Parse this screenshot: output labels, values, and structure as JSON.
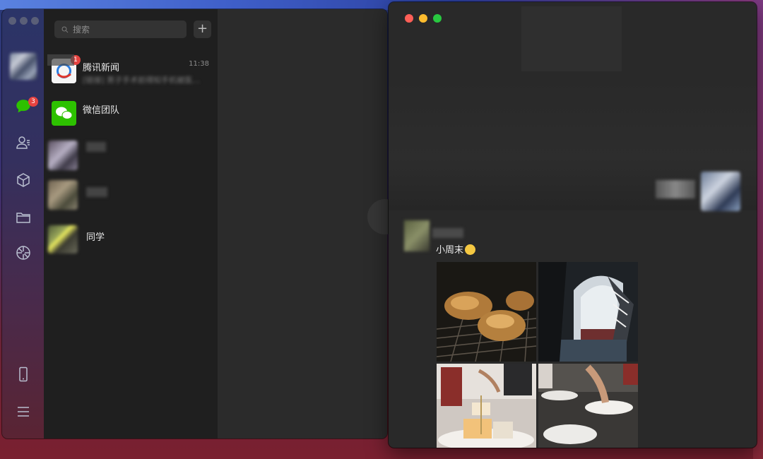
{
  "sidebar": {
    "chat_badge": "3",
    "icons": [
      "chat-icon",
      "contacts-icon",
      "cube-icon",
      "folder-icon",
      "moments-icon",
      "phone-icon",
      "menu-icon"
    ]
  },
  "chat_list": {
    "search_placeholder": "搜索",
    "add_label": "+",
    "items": [
      {
        "name": "腾讯新闻",
        "time": "11:38",
        "preview": "[链接] 男子手术前得知手机被医…",
        "badge": "1"
      },
      {
        "name": "微信团队",
        "time": "",
        "preview": ""
      },
      {
        "name": "",
        "time": "",
        "preview": ""
      },
      {
        "name": "",
        "time": "",
        "preview": ""
      },
      {
        "name": "同学",
        "time": "",
        "preview": ""
      }
    ]
  },
  "chat_window": {
    "message_text": "小周末",
    "photos": [
      "grilled-food",
      "arched-window",
      "dessert-tea-set",
      "table-plates"
    ]
  },
  "colors": {
    "badge": "#e64340",
    "wechat_green": "#2dc100",
    "close": "#ff5f57",
    "minimize": "#febc2e",
    "zoom": "#28c840"
  }
}
